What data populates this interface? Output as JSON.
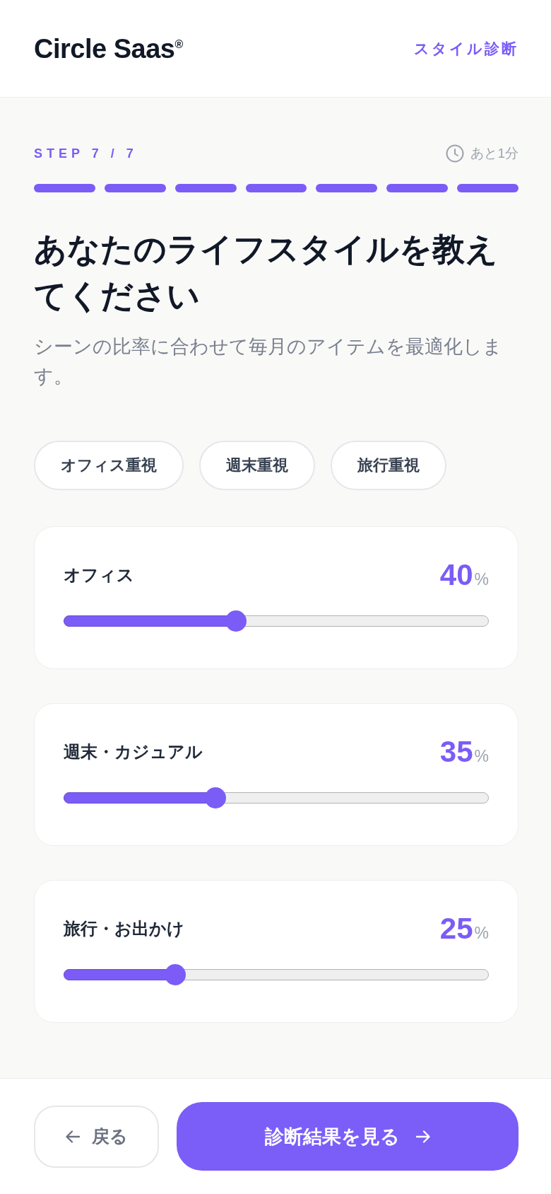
{
  "header": {
    "logo": "Circle Saas$^{®}$",
    "section_label": "スタイル診断"
  },
  "progress": {
    "step_label": "STEP 7 / 7",
    "time_left": "あと1分",
    "segments": [
      {
        "done": true
      },
      {
        "done": true
      },
      {
        "done": true
      },
      {
        "done": true
      },
      {
        "done": true
      },
      {
        "done": true
      },
      {
        "done": true
      }
    ]
  },
  "question": {
    "title": "あなたのライフスタイルを教えてください",
    "description": "シーンの比率に合わせて毎月のアイテムを最適化します。"
  },
  "presets": [
    {
      "label": "オフィス重視",
      "selected": false
    },
    {
      "label": "週末重視",
      "selected": false
    },
    {
      "label": "旅行重視",
      "selected": false
    }
  ],
  "sliders": [
    {
      "label": "オフィス",
      "value": "40",
      "unit": "%",
      "level": 0.4
    },
    {
      "label": "週末・カジュアル",
      "value": "35",
      "unit": "%",
      "level": 0.35
    },
    {
      "label": "旅行・お出かけ",
      "value": "25",
      "unit": "%",
      "level": 0.25
    }
  ],
  "footer": {
    "back_button": "戻る",
    "next_button": "診断結果を見る"
  }
}
